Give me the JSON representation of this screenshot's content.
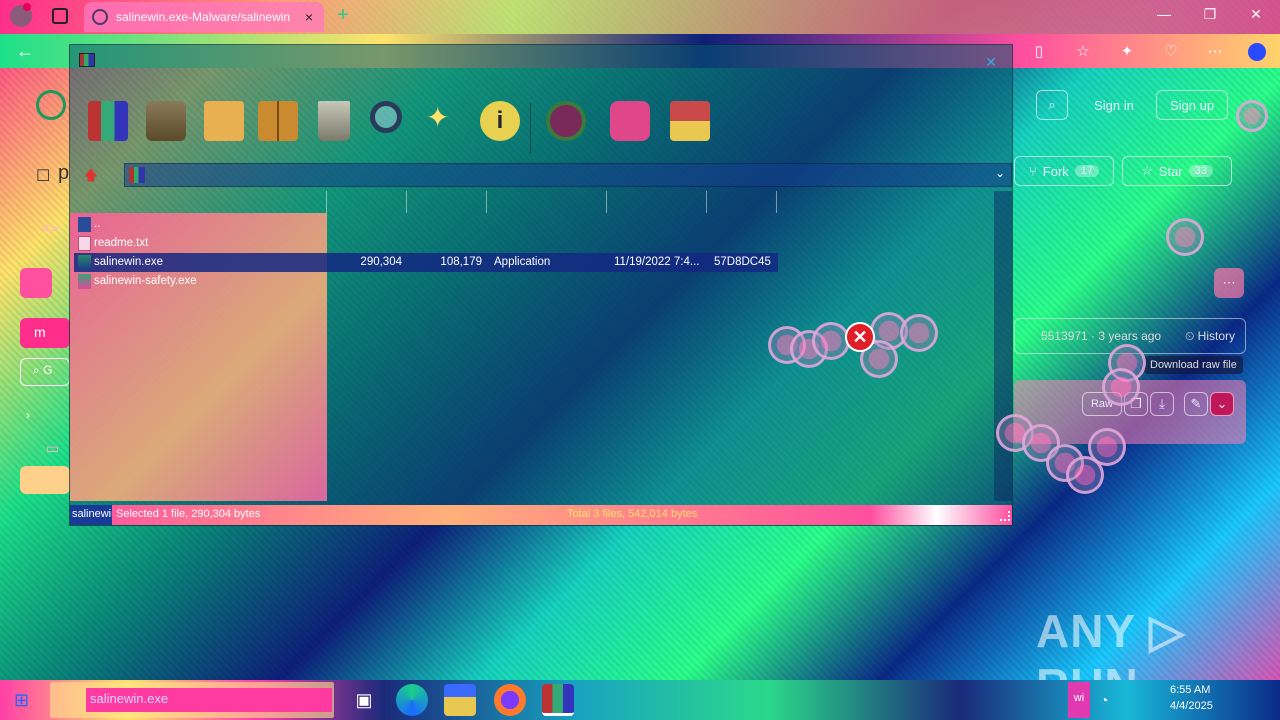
{
  "browser": {
    "tab_title": "salinewin.exe-Malware/salinewin",
    "tab_close": "×",
    "new_tab": "+",
    "window_controls": {
      "minimize": "—",
      "maximize": "❐",
      "close": "✕"
    },
    "back": "←"
  },
  "github_bg": {
    "sign_in": "Sign in",
    "sign_up": "Sign up",
    "fork_label": "Fork",
    "fork_count": "17",
    "star_label": "Star",
    "star_count": "33",
    "commit_text": "5513971 · 3 years ago",
    "history_label": "History",
    "raw_label": "Raw",
    "download_tooltip": "Download raw file",
    "left_partial_1": "p",
    "left_partial_2": "<>",
    "left_partial_3": "m",
    "left_partial_4": "G"
  },
  "winrar": {
    "close": "✕",
    "toolbar": [
      {
        "name": "add-icon"
      },
      {
        "name": "extract-to-icon"
      },
      {
        "name": "test-icon"
      },
      {
        "name": "view-icon"
      },
      {
        "name": "delete-icon"
      },
      {
        "name": "find-icon"
      },
      {
        "name": "wizard-icon"
      },
      {
        "name": "info-icon"
      },
      {
        "name": "virusscan-icon"
      },
      {
        "name": "comment-icon"
      },
      {
        "name": "sfx-icon"
      }
    ],
    "up_arrow": "🡅",
    "combo_arrow": "⌄",
    "files": [
      {
        "name": "..",
        "size": "",
        "packed": "",
        "type": "",
        "modified": "",
        "crc": ""
      },
      {
        "name": "readme.txt",
        "size": "",
        "packed": "",
        "type": "",
        "modified": "",
        "crc": ""
      },
      {
        "name": "salinewin.exe",
        "size": "290,304",
        "packed": "108,179",
        "type": "Application",
        "modified": "11/19/2022 7:4...",
        "crc": "57D8DC45"
      },
      {
        "name": "salinewin-safety.exe",
        "size": "",
        "packed": "",
        "type": "",
        "modified": "",
        "crc": ""
      }
    ],
    "status_lock": "salinewin.exe",
    "status_left": "Selected 1 file, 290,304 bytes",
    "status_right": "Total 3 files, 542,014 bytes",
    "error_glyph": "✕"
  },
  "taskbar": {
    "start": "⊞",
    "search_text": "salinewin.exe",
    "lang": "wi",
    "time": "6:55 AM",
    "date": "4/4/2025"
  },
  "watermark": "ANY ▷ RUN",
  "colors": {
    "selection": "#14288a",
    "error_red": "#e01e28",
    "status_pink": "#ff4fa0"
  }
}
